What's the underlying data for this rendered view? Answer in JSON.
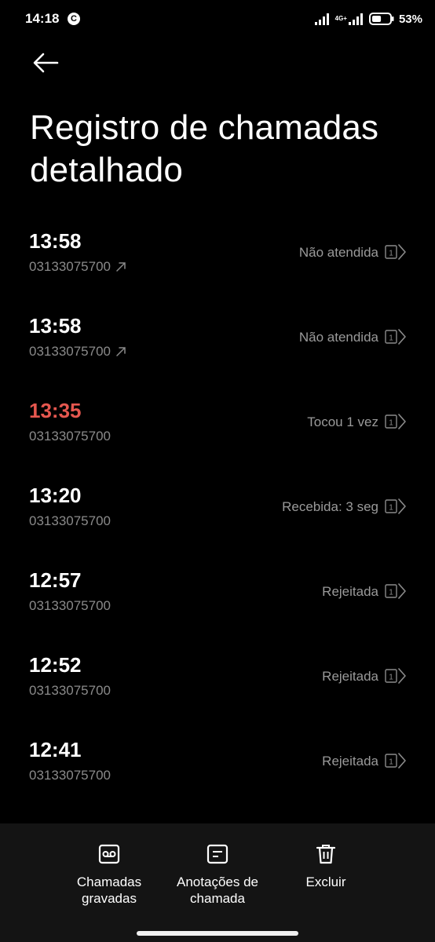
{
  "status_bar": {
    "time": "14:18",
    "notification_letter": "C",
    "network_label": "4G+",
    "battery_percent": "53%",
    "battery_level": 0.53
  },
  "header": {
    "back_icon": "arrow-left-icon",
    "title": "Registro de chamadas detalhado"
  },
  "calls": [
    {
      "time": "13:58",
      "number": "03133075700",
      "status": "Não atendida",
      "outgoing": true,
      "missed": false
    },
    {
      "time": "13:58",
      "number": "03133075700",
      "status": "Não atendida",
      "outgoing": true,
      "missed": false
    },
    {
      "time": "13:35",
      "number": "03133075700",
      "status": "Tocou 1 vez",
      "outgoing": false,
      "missed": true
    },
    {
      "time": "13:20",
      "number": "03133075700",
      "status": "Recebida: 3 seg",
      "outgoing": false,
      "missed": false
    },
    {
      "time": "12:57",
      "number": "03133075700",
      "status": "Rejeitada",
      "outgoing": false,
      "missed": false
    },
    {
      "time": "12:52",
      "number": "03133075700",
      "status": "Rejeitada",
      "outgoing": false,
      "missed": false
    },
    {
      "time": "12:41",
      "number": "03133075700",
      "status": "Rejeitada",
      "outgoing": false,
      "missed": false
    }
  ],
  "sim_label": "1",
  "actions": {
    "recorded_line1": "Chamadas",
    "recorded_line2": "gravadas",
    "notes_line1": "Anotações de",
    "notes_line2": "chamada",
    "delete": "Excluir"
  },
  "colors": {
    "background": "#000000",
    "missed": "#e5574f",
    "secondary_text": "#8a8a8a",
    "bottom_bar": "#141414"
  }
}
